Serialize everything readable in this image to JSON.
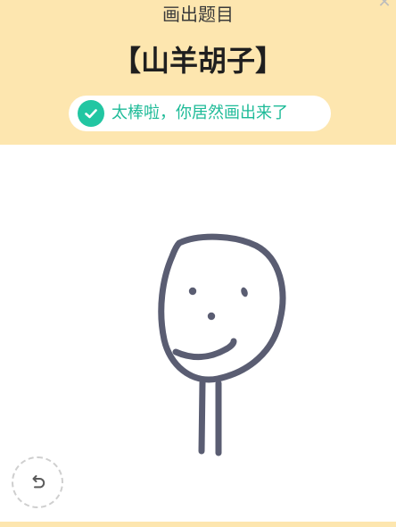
{
  "header": {
    "title": "画出题目",
    "word": "【山羊胡子】",
    "result_text": "太棒啦，你居然画出来了"
  },
  "icons": {
    "close": "close-icon",
    "check": "check-icon",
    "undo": "undo-icon"
  },
  "colors": {
    "header_background": "#FDE6AF",
    "success_accent": "#22C6A2",
    "ink": "#5A5D72"
  }
}
